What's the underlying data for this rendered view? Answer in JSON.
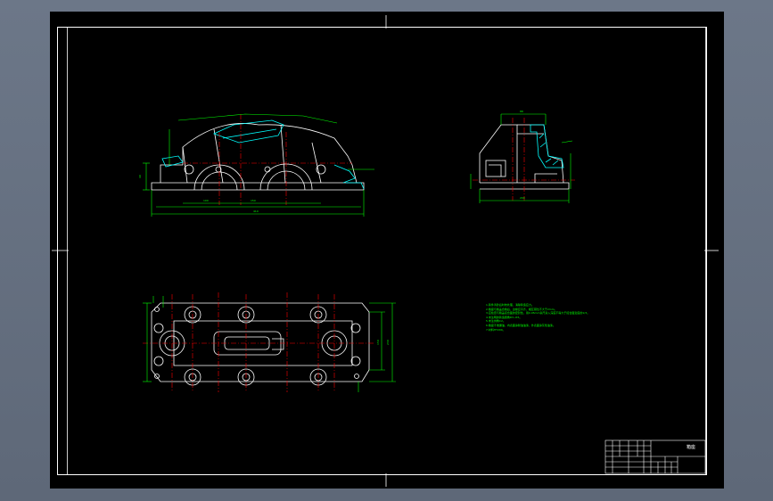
{
  "drawing": {
    "background_color": "#000000",
    "frame_color": "#ffffff",
    "outline_color": "#ffffff",
    "dimension_color": "#00ff00",
    "centerline_color": "#ff0000",
    "hatch_color": "#00ffff",
    "title_block": {
      "title": "箱座"
    },
    "notes": [
      "1.铸件清砂后时效处理，消除铸造应力。",
      "2.箱座与箱盖合箱后，边缘应平齐，相互错位不大于2mm。",
      "3.应检查与箱盖接合面的密封性，用0.05mm塞尺塞入深度不得大于接合面宽度的1/3。",
      "4.未注明的铸造圆角R3~R5。",
      "5.未注倒角C2。",
      "6.箱座不准漏油，内表面涂耐油油漆，外表面涂灰色油漆。",
      "7.材料HT200。"
    ]
  }
}
